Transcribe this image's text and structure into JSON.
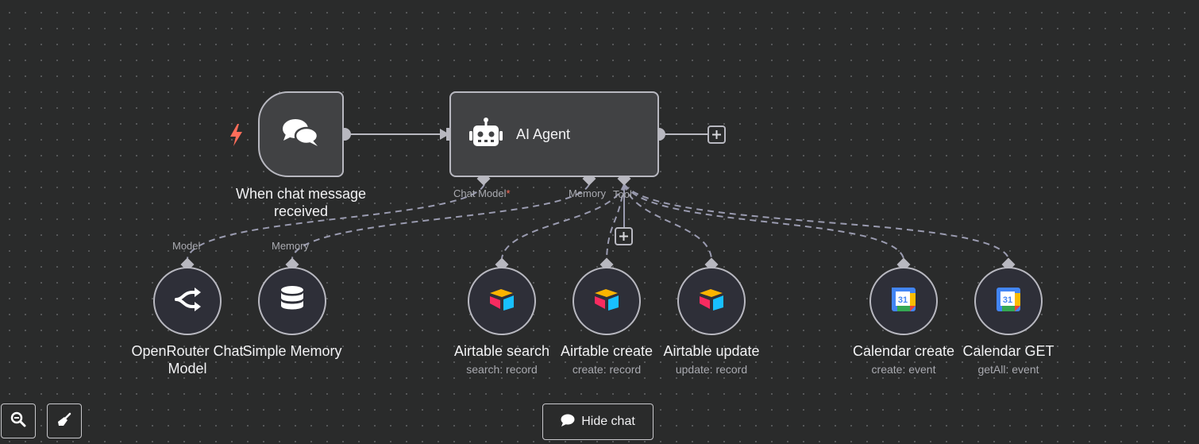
{
  "canvas": {
    "trigger_node": {
      "label_line1": "When chat message",
      "label_line2": "received",
      "icon": "chat-bubbles-icon",
      "trigger_badge_icon": "lightning-bolt-icon"
    },
    "agent_node": {
      "title": "AI Agent",
      "icon": "robot-icon",
      "ports": {
        "chat_model": "Chat Model",
        "chat_model_required": "*",
        "memory": "Memory",
        "tool": "Tool"
      }
    },
    "sub_nodes": [
      {
        "key": "openrouter",
        "label_line1": "OpenRouter Chat",
        "label_line2": "Model",
        "sub": "",
        "port_label": "Model",
        "icon": "openrouter-icon"
      },
      {
        "key": "simple_memory",
        "label_line1": "Simple Memory",
        "label_line2": "",
        "sub": "",
        "port_label": "Memory",
        "icon": "database-icon"
      },
      {
        "key": "airtable_search",
        "label_line1": "Airtable search",
        "label_line2": "",
        "sub": "search: record",
        "port_label": "",
        "icon": "airtable-icon"
      },
      {
        "key": "airtable_create",
        "label_line1": "Airtable create",
        "label_line2": "",
        "sub": "create: record",
        "port_label": "",
        "icon": "airtable-icon"
      },
      {
        "key": "airtable_update",
        "label_line1": "Airtable update",
        "label_line2": "",
        "sub": "update: record",
        "port_label": "",
        "icon": "airtable-icon"
      },
      {
        "key": "calendar_create",
        "label_line1": "Calendar create",
        "label_line2": "",
        "sub": "create: event",
        "port_label": "",
        "icon": "google-calendar-icon",
        "calendar_day": "31"
      },
      {
        "key": "calendar_get",
        "label_line1": "Calendar GET",
        "label_line2": "",
        "sub": "getAll: event",
        "port_label": "",
        "icon": "google-calendar-icon",
        "calendar_day": "31"
      }
    ]
  },
  "controls": {
    "zoom_out_icon": "zoom-out-icon",
    "clean_icon": "broom-icon",
    "hide_chat_label": "Hide chat",
    "hide_chat_icon": "chat-bubble-icon"
  },
  "colors": {
    "background": "#2a2b2b",
    "node_fill": "#414244",
    "node_border": "#b8b8c0",
    "sub_node_fill": "#2e2f38",
    "connection": "#9a9bb0",
    "trigger_bolt": "#ff6d5a"
  }
}
